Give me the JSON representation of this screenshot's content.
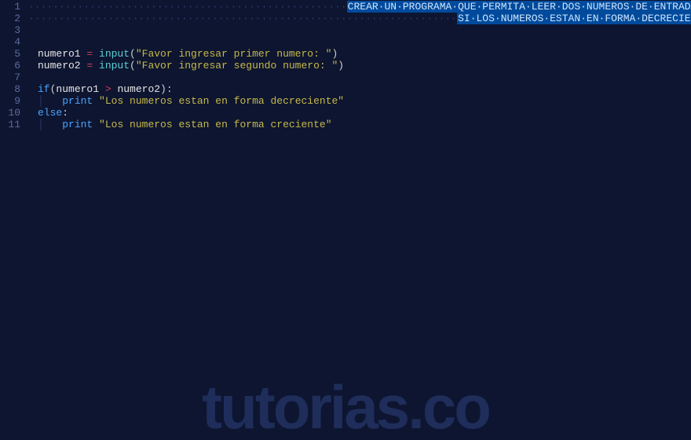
{
  "gutter": {
    "start": 1,
    "end": 11
  },
  "code": {
    "comment1_dots": "····················································",
    "comment1": "CREAR·UN·PROGRAMA·QUE·PERMITA·LEER·DOS·NUMEROS·DE·ENTRADA·E·INDICAR",
    "comment2_dots": "······································································",
    "comment2": "SI·LOS·NUMEROS·ESTAN·EN·FORMA·DECRECIENTE·O·CRECIENTE",
    "l5_var": "numero1",
    "eq": " = ",
    "input_fn": "input",
    "l5_str": "\"Favor ingresar primer numero: \"",
    "l6_var": "numero2",
    "l6_str": "\"Favor ingresar segundo numero: \"",
    "if_kw": "if",
    "gt": " > ",
    "colon": ":",
    "print_fn": "print",
    "l9_str": "\"Los numeros estan en forma decreciente\"",
    "else_kw": "else",
    "l11_str": "\"Los numeros estan en forma creciente\"",
    "indent1_pipe": "│   "
  },
  "watermark": "tutorias.co"
}
